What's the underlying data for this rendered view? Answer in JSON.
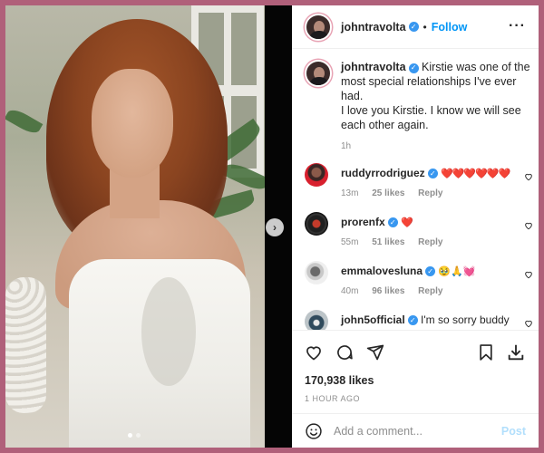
{
  "header": {
    "username": "johntravolta",
    "verified_badge": "✓",
    "separator": "•",
    "follow_label": "Follow",
    "more_label": "···"
  },
  "caption": {
    "username": "johntravolta",
    "text": "Kirstie was one of the most special relationships I've ever had.",
    "text2": "I love you Kirstie. I know we will see each other again.",
    "time": "1h"
  },
  "comments": [
    {
      "username": "ruddyrrodriguez",
      "text": "❤️❤️❤️❤️❤️❤️",
      "time": "13m",
      "likes": "25 likes",
      "reply": "Reply"
    },
    {
      "username": "prorenfx",
      "text": "❤️",
      "time": "55m",
      "likes": "51 likes",
      "reply": "Reply"
    },
    {
      "username": "emmalovesluna",
      "text": "🥹🙏💓",
      "time": "40m",
      "likes": "96 likes",
      "reply": "Reply"
    },
    {
      "username": "john5official",
      "text": "I'm so sorry buddy",
      "time": "",
      "likes": "",
      "reply": ""
    }
  ],
  "actions": {
    "likes": "170,938 likes",
    "posted": "1 HOUR AGO"
  },
  "add_comment": {
    "placeholder": "Add a comment...",
    "post_label": "Post"
  },
  "colors": {
    "border": "#b0607a",
    "link": "#0095f6",
    "verified": "#3897f0",
    "heart": "#ed4956"
  },
  "media": {
    "next_label": "›"
  }
}
